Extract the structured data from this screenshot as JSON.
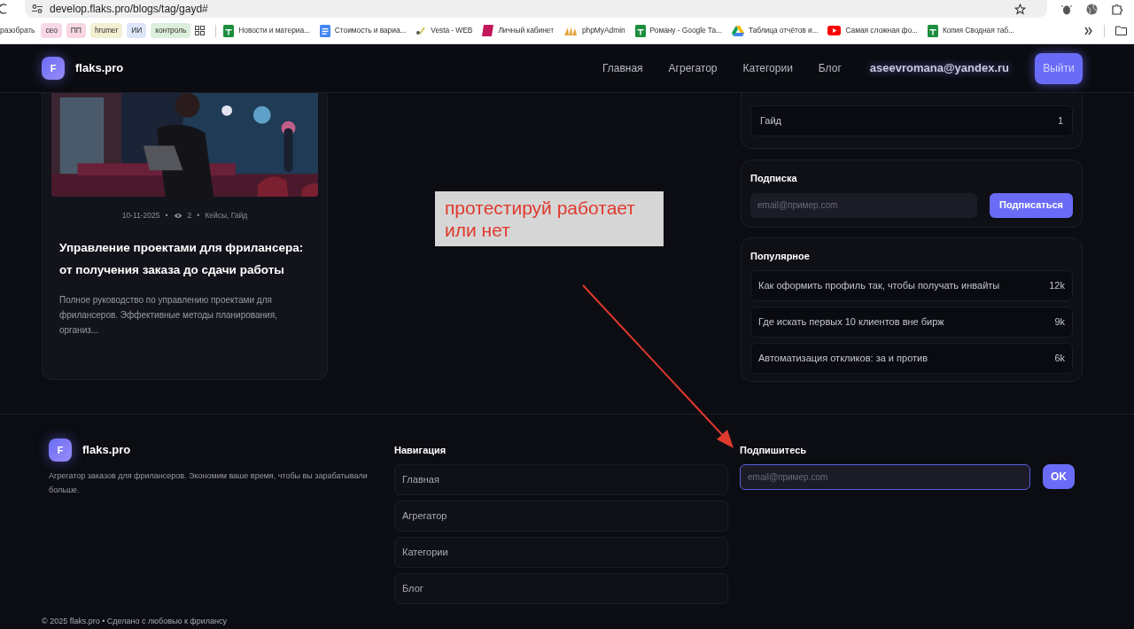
{
  "browser": {
    "url": "develop.flaks.pro/blogs/tag/gayd#",
    "bookmarks": [
      {
        "kind": "plain",
        "label": "разобрать"
      },
      {
        "kind": "tag",
        "label": "сео",
        "color": "#f8d7e8"
      },
      {
        "kind": "tag",
        "label": "ПП",
        "color": "#f8d7e0"
      },
      {
        "kind": "tag",
        "label": "hrumer",
        "color": "#f3efd2"
      },
      {
        "kind": "tag",
        "label": "ИИ",
        "color": "#dde6f8"
      },
      {
        "kind": "tag",
        "label": "контроль",
        "color": "#dcefdc"
      },
      {
        "kind": "apps"
      },
      {
        "kind": "sheet",
        "label": "Новости и материа..."
      },
      {
        "kind": "doc",
        "label": "Стоимость и вариа..."
      },
      {
        "kind": "vesta",
        "label": "Vesta - WEB"
      },
      {
        "kind": "cabinet",
        "label": "Личный кабинет"
      },
      {
        "kind": "pma",
        "label": "phpMyAdmin"
      },
      {
        "kind": "sheet",
        "label": "Роману - Google Та..."
      },
      {
        "kind": "drive",
        "label": "Таблица отчётов и..."
      },
      {
        "kind": "video",
        "label": "Самая сложная фо..."
      },
      {
        "kind": "sheet",
        "label": "Копия Сводная таб..."
      }
    ]
  },
  "header": {
    "logo_letter": "F",
    "brand": "flaks.pro",
    "nav": [
      "Главная",
      "Агрегатор",
      "Категории",
      "Блог"
    ],
    "user": "aseevromana@yandex.ru",
    "logout": "Выйти"
  },
  "post": {
    "separator": "•",
    "date": "10-11-2025",
    "views": "2",
    "tags": "Кейсы, Гайд",
    "title": "Управление проектами для фрилансера: от получения заказа до сдачи работы",
    "excerpt": "Полное руководство по управлению проектами для фрилансеров. Эффективные методы планирования, организ..."
  },
  "sidebar": {
    "categories": [
      {
        "name": "Гайд",
        "count": "1"
      }
    ],
    "subscribe": {
      "title": "Подписка",
      "placeholder": "email@пример.com",
      "button": "Подписаться"
    },
    "popular": {
      "title": "Популярное",
      "items": [
        {
          "title": "Как оформить профиль так, чтобы получать инвайты",
          "views": "12k"
        },
        {
          "title": "Где искать первых 10 клиентов вне бирж",
          "views": "9k"
        },
        {
          "title": "Автоматизация откликов: за и против",
          "views": "6k"
        }
      ]
    }
  },
  "annotation": {
    "text": "протестируй работает или нет"
  },
  "footer": {
    "logo_letter": "F",
    "brand": "flaks.pro",
    "description": "Агрегатор заказов для фрилансеров. Экономим ваше время, чтобы вы зарабатывали больше.",
    "nav_title": "Навигация",
    "nav": [
      "Главная",
      "Агрегатор",
      "Категории",
      "Блог"
    ],
    "subscribe_title": "Подпишитесь",
    "placeholder": "email@пример.com",
    "focused": true,
    "button": "OK",
    "copyright": "© 2025 flaks.pro • Сделано с любовью к фрилансу"
  }
}
